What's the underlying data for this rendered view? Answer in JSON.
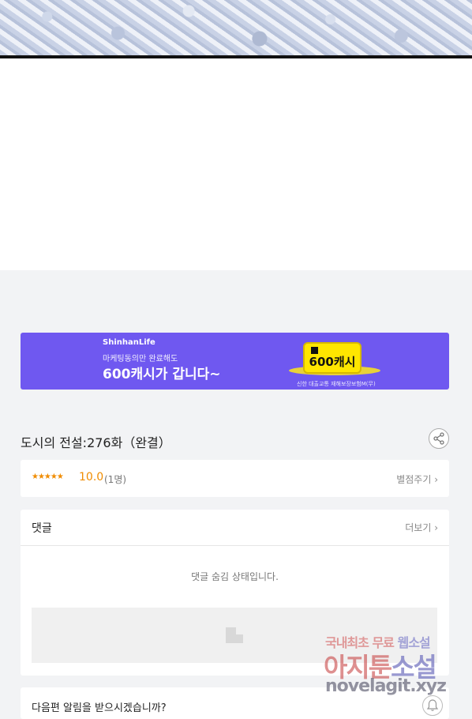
{
  "banner": {
    "brand": "ShinhanLife",
    "subtitle": "마케팅동의만 완료해도",
    "headline": "600캐시가 갑니다~",
    "prize_label": "600캐시",
    "fineprint": "신한 대출교통 재해보장보험M(무)",
    "accent": "#6f58f0"
  },
  "episode": {
    "title": "도시의 전설:276화（완결）",
    "share_icon": "share-icon"
  },
  "rating": {
    "stars": "★★★★★",
    "score": "10.0",
    "count": "(1명)",
    "rate_link": "별점주기 ›",
    "color": "#f08c00"
  },
  "comments": {
    "label": "댓글",
    "more_link": "더보기 ›",
    "hidden_message": "댓글 숨김 상태입니다."
  },
  "notify": {
    "label": "다음편 알림을 받으시겠습니까?",
    "bell_icon": "bell-icon"
  },
  "watermark": {
    "line1_a": "국내최초 무료 ",
    "line1_b": "웹소설",
    "line2_a": "아지툰",
    "line2_b": "소설",
    "line3": "novelagit.xyz"
  }
}
